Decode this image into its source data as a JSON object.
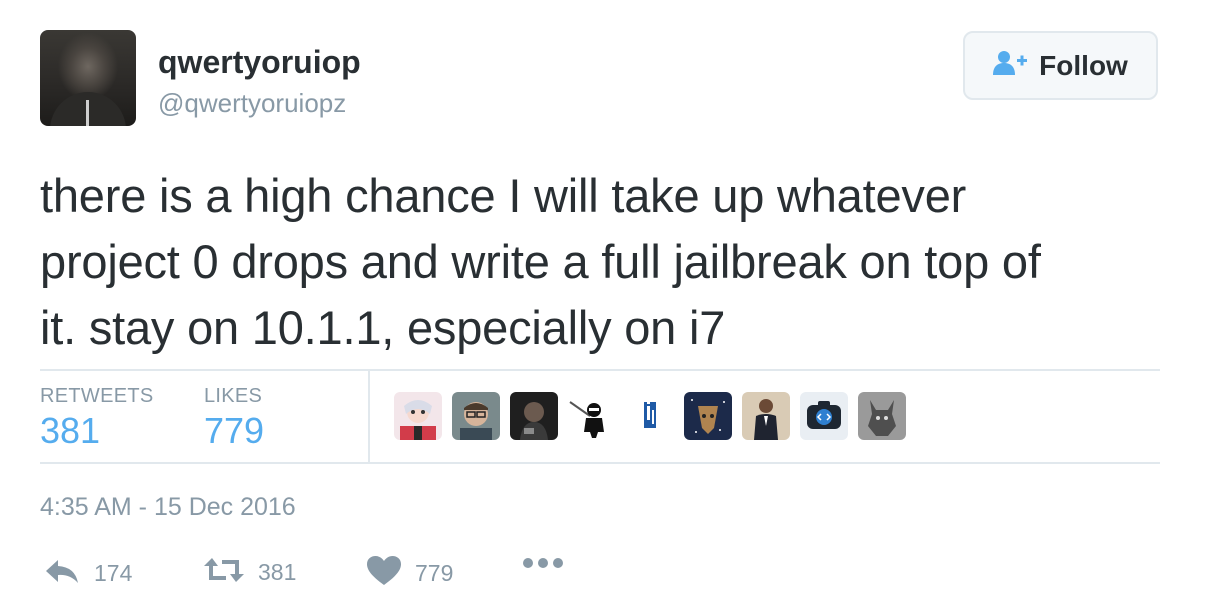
{
  "author": {
    "name": "qwertyoruiop",
    "handle": "@qwertyoruiopz"
  },
  "follow_button": {
    "label": "Follow"
  },
  "tweet": {
    "lines": [
      "there is a high chance I will take up whatever",
      "project 0 drops and write a full jailbreak on top of",
      "it. stay on 10.1.1, especially on i7"
    ]
  },
  "stats": {
    "retweets_label": "RETWEETS",
    "retweets_value": "381",
    "likes_label": "LIKES",
    "likes_value": "779"
  },
  "likers": [
    {
      "icon": "harley-quinn-avatar"
    },
    {
      "icon": "glasses-man-avatar"
    },
    {
      "icon": "dark-figure-avatar"
    },
    {
      "icon": "ninja-avatar"
    },
    {
      "icon": "blue-i-logo-avatar"
    },
    {
      "icon": "starry-face-avatar"
    },
    {
      "icon": "suited-man-avatar"
    },
    {
      "icon": "code-camera-avatar"
    },
    {
      "icon": "gray-creature-avatar"
    }
  ],
  "timestamp": "4:35 AM - 15 Dec 2016",
  "actions": {
    "reply_count": "174",
    "retweet_count": "381",
    "like_count": "779"
  },
  "colors": {
    "accent": "#55acee",
    "muted": "#8899a6",
    "text": "#292f33",
    "divider": "#e1e8ed"
  }
}
